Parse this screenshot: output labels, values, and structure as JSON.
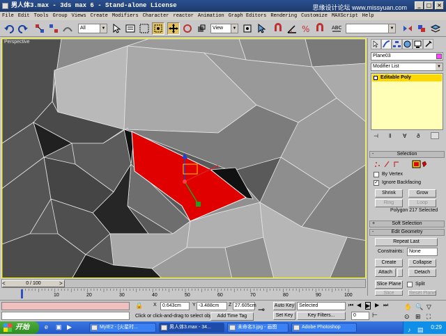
{
  "window": {
    "title": "男人体3.max - 3ds max 6 - Stand-alone License",
    "watermark": "思缘设计论坛 www.missyuan.com"
  },
  "menu": [
    "File",
    "Edit",
    "Tools",
    "Group",
    "Views",
    "Create",
    "Modifiers",
    "Character",
    "reactor",
    "Animation",
    "Graph Editors",
    "Rendering",
    "Customize",
    "MAXScript",
    "Help"
  ],
  "toolbar": {
    "selection_filter": "All",
    "reference_coord": "View"
  },
  "viewport": {
    "label": "Perspective"
  },
  "command_panel": {
    "object_name": "Plane03",
    "modifier_list": "Modifier List",
    "stack_item": "Editable Poly",
    "selection": {
      "title": "Selection",
      "by_vertex": "By Vertex",
      "ignore_backfacing": "Ignore Backfacing",
      "shrink": "Shrink",
      "grow": "Grow",
      "ring": "Ring",
      "loop": "Loop",
      "status": "Polygon 217 Selected"
    },
    "soft_selection": {
      "title": "Soft Selection"
    },
    "edit_geometry": {
      "title": "Edit Geometry",
      "repeat_last": "Repeat Last",
      "constraints": "Constraints:",
      "constraints_value": "None",
      "create": "Create",
      "collapse": "Collapse",
      "attach": "Attach",
      "detach": "Detach",
      "slice_plane": "Slice Plane",
      "split": "Split",
      "slice": "Slice",
      "reset_plane": "Reset Plane"
    }
  },
  "timeline": {
    "frame": "0 / 100",
    "ticks": [
      "10",
      "20",
      "30",
      "40",
      "50",
      "60",
      "70",
      "80",
      "90",
      "100"
    ]
  },
  "status": {
    "prompt": "Click or click-and-drag to select obj",
    "add_time_tag": "Add Time Tag",
    "x": "0.643cm",
    "y": "-3.488cm",
    "z": "27.605cm",
    "auto_key": "Auto Key",
    "set_key": "Set Key",
    "key_mode": "Selected",
    "key_filters": "Key Filters...",
    "current_frame": "0"
  },
  "taskbar": {
    "start": "开始",
    "tasks": [
      "MyIE2 - [火星时...",
      "男人体3.max - 34...",
      "未命名3.jpg - 画图",
      "Adobe Photoshop"
    ],
    "clock": "0:29"
  },
  "colors": {
    "selected_face": "#e00000",
    "viewport_border": "#ffff00",
    "taskbar": "#2457c9"
  }
}
